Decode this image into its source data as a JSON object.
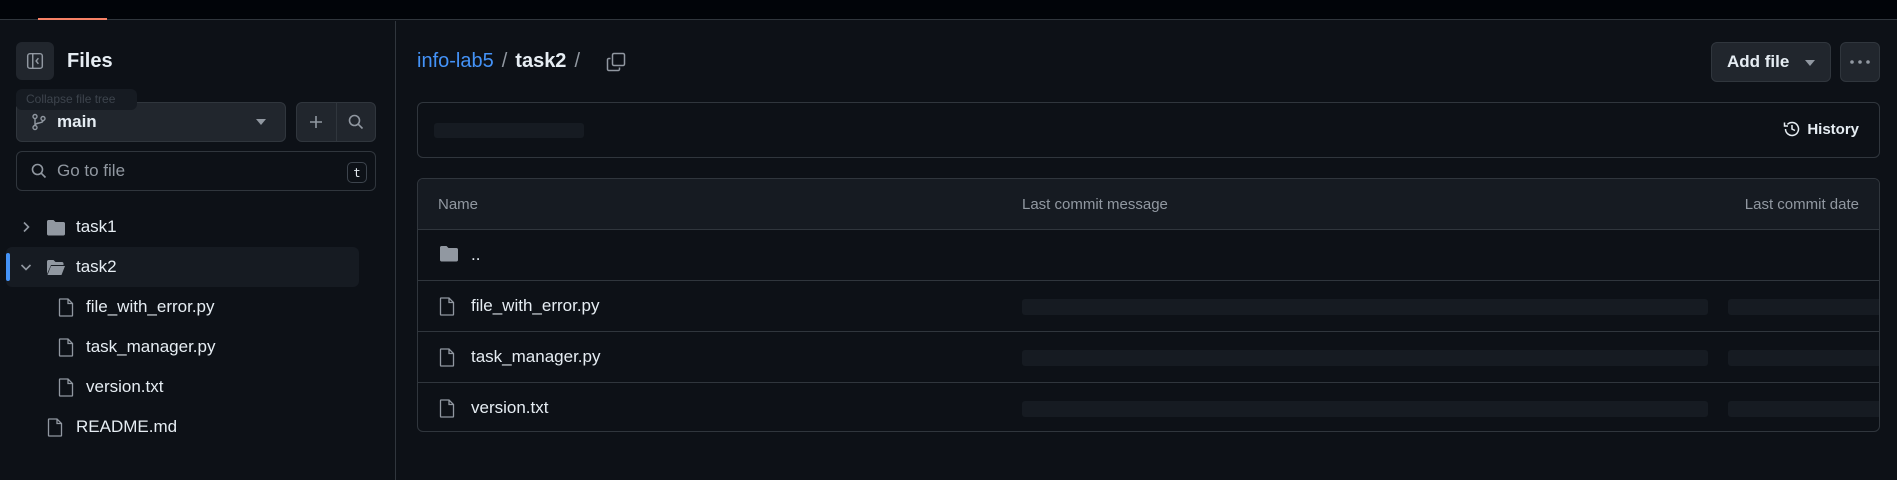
{
  "sidebar": {
    "title": "Files",
    "tooltip": "Collapse file tree",
    "branch": "main",
    "search_placeholder": "Go to file",
    "search_shortcut": "t",
    "tree": [
      {
        "label": "task1",
        "type": "folder",
        "expanded": false
      },
      {
        "label": "task2",
        "type": "folder",
        "expanded": true,
        "selected": true
      },
      {
        "label": "file_with_error.py",
        "type": "file"
      },
      {
        "label": "task_manager.py",
        "type": "file"
      },
      {
        "label": "version.txt",
        "type": "file"
      },
      {
        "label": "README.md",
        "type": "file"
      }
    ]
  },
  "breadcrumb": {
    "repo": "info-lab5",
    "sep1": "/",
    "current": "task2",
    "sep2": "/"
  },
  "toolbar": {
    "add_file_label": "Add file",
    "more_label": "···"
  },
  "commit_bar": {
    "history_label": "History"
  },
  "table": {
    "headers": [
      "Name",
      "Last commit message",
      "Last commit date"
    ],
    "rows": [
      {
        "name": "..",
        "type": "folder"
      },
      {
        "name": "file_with_error.py",
        "type": "file"
      },
      {
        "name": "task_manager.py",
        "type": "file"
      },
      {
        "name": "version.txt",
        "type": "file"
      }
    ]
  },
  "colors": {
    "background": "#0d1117",
    "accent": "#4493f8",
    "border": "#30363d",
    "tab_underline": "#f78166"
  }
}
